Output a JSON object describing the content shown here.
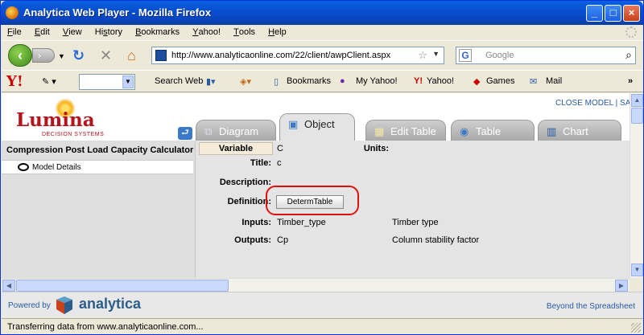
{
  "window": {
    "title": "Analytica Web Player - Mozilla Firefox",
    "buttons": {
      "minimize": "_",
      "maximize": "□",
      "close": "×"
    }
  },
  "menubar": {
    "items": [
      {
        "key": "F",
        "rest": "ile"
      },
      {
        "key": "E",
        "rest": "dit"
      },
      {
        "key": "V",
        "rest": "iew"
      },
      {
        "key": "",
        "rest": "Hi",
        "key2": "s",
        "rest2": "tory"
      },
      {
        "key": "B",
        "rest": "ookmarks"
      },
      {
        "key": "Y",
        "rest": "ahoo!"
      },
      {
        "key": "T",
        "rest": "ools"
      },
      {
        "key": "H",
        "rest": "elp"
      }
    ]
  },
  "navbar": {
    "url": "http://www.analyticaonline.com/22/client/awpClient.aspx",
    "search_placeholder": "Google",
    "icons": [
      "back-icon",
      "forward-icon",
      "reload-icon",
      "stop-icon",
      "home-icon"
    ]
  },
  "yahoo_toolbar": {
    "search_web": "Search Web",
    "bookmarks": "Bookmarks",
    "my_yahoo": "My Yahoo!",
    "yahoo": "Yahoo!",
    "games": "Games",
    "mail": "Mail",
    "more": "»"
  },
  "app": {
    "logo_word": "Lumina",
    "logo_sub": "DECISION SYSTEMS",
    "close_model": "CLOSE MODEL | SAV",
    "tabs": [
      {
        "label": "Diagram",
        "icon": "diagram-icon",
        "active": false
      },
      {
        "label": "Object",
        "icon": "object-icon",
        "active": true
      },
      {
        "label": "Edit Table",
        "icon": "edit-table-icon",
        "active": false
      },
      {
        "label": "Table",
        "icon": "table-icon",
        "active": false
      },
      {
        "label": "Chart",
        "icon": "chart-icon",
        "active": false
      }
    ],
    "sidebar": {
      "title": "Compression Post Load Capacity Calculator",
      "items": [
        {
          "label": "Model Details"
        }
      ]
    },
    "object": {
      "class": "Variable",
      "identifier": "C",
      "units_label": "Units:",
      "title_label": "Title:",
      "title_value": "c",
      "description_label": "Description:",
      "definition_label": "Definition:",
      "definition_button": "DetermTable",
      "inputs_label": "Inputs:",
      "inputs_id": "Timber_type",
      "inputs_title": "Timber type",
      "outputs_label": "Outputs:",
      "outputs_id": "Cp",
      "outputs_title": "Column stability factor"
    },
    "footer": {
      "powered": "Powered by",
      "brand": "analytica",
      "tagline": "Beyond the Spreadsheet"
    }
  },
  "status": {
    "text": "Transferring data from www.analyticaonline.com..."
  },
  "colors": {
    "accent": "#b5121b",
    "link": "#2a5aa5",
    "highlight": "#e01010"
  }
}
